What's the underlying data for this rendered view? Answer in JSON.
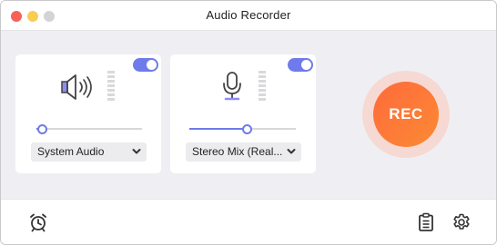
{
  "window": {
    "title": "Audio Recorder"
  },
  "system_audio": {
    "enabled": true,
    "icon": "speaker-icon",
    "volume": 0.05,
    "source_label": "System Audio"
  },
  "microphone": {
    "enabled": true,
    "icon": "microphone-icon",
    "volume": 0.54,
    "source_label": "Stereo Mix (Real..."
  },
  "record_button": {
    "label": "REC"
  },
  "bottom": {
    "left_icon": "alarm-clock-icon",
    "right_icons": [
      "clipboard-list-icon",
      "gear-icon"
    ]
  },
  "colors": {
    "accent": "#6e7bea",
    "rec": "#ff7038",
    "rec_ring": "#f6d9d3"
  }
}
